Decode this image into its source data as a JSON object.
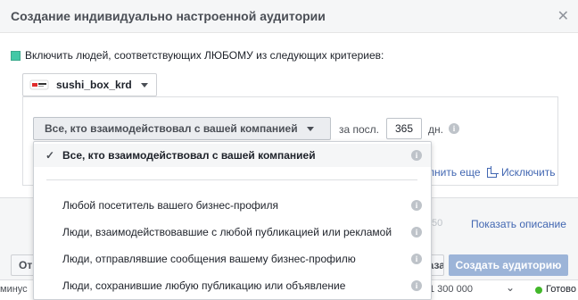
{
  "dialog": {
    "title": "Создание индивидуально настроенной аудитории",
    "close_icon": "close-icon"
  },
  "include": {
    "text": "Включить людей, соответствующих ЛЮБОМУ из следующих критериев:",
    "swatch_color": "#42c8a6"
  },
  "source": {
    "label": "sushi_box_krd",
    "icon": "sushi-box-logo-icon"
  },
  "rule": {
    "select_label": "Все, кто взаимодействовал с вашей компанией",
    "period_label": "за посл.",
    "days_value": "365",
    "days_unit": "дн."
  },
  "actions": {
    "add_more": "лнить еще",
    "exclude": "Исключить"
  },
  "dropdown": {
    "selected": "Все, кто взаимодействовал с вашей компанией",
    "items": [
      "Любой посетитель вашего бизнес-профиля",
      "Люди, взаимодействовавшие с любой публикацией или рекламой",
      "Люди, отправлявшие сообщения вашему бизнес-профилю",
      "Люди, сохранившие любую публикацию или объявление"
    ]
  },
  "footer": {
    "name_hint": "50",
    "show_description": "Показать описание",
    "back_label": "Отмена",
    "cancel_label": "Назад",
    "create_label": "Создать аудиторию"
  },
  "status": {
    "left_text": "минус",
    "number": "1 300 000",
    "ready": "Готово",
    "ready_color": "#42b72a"
  }
}
